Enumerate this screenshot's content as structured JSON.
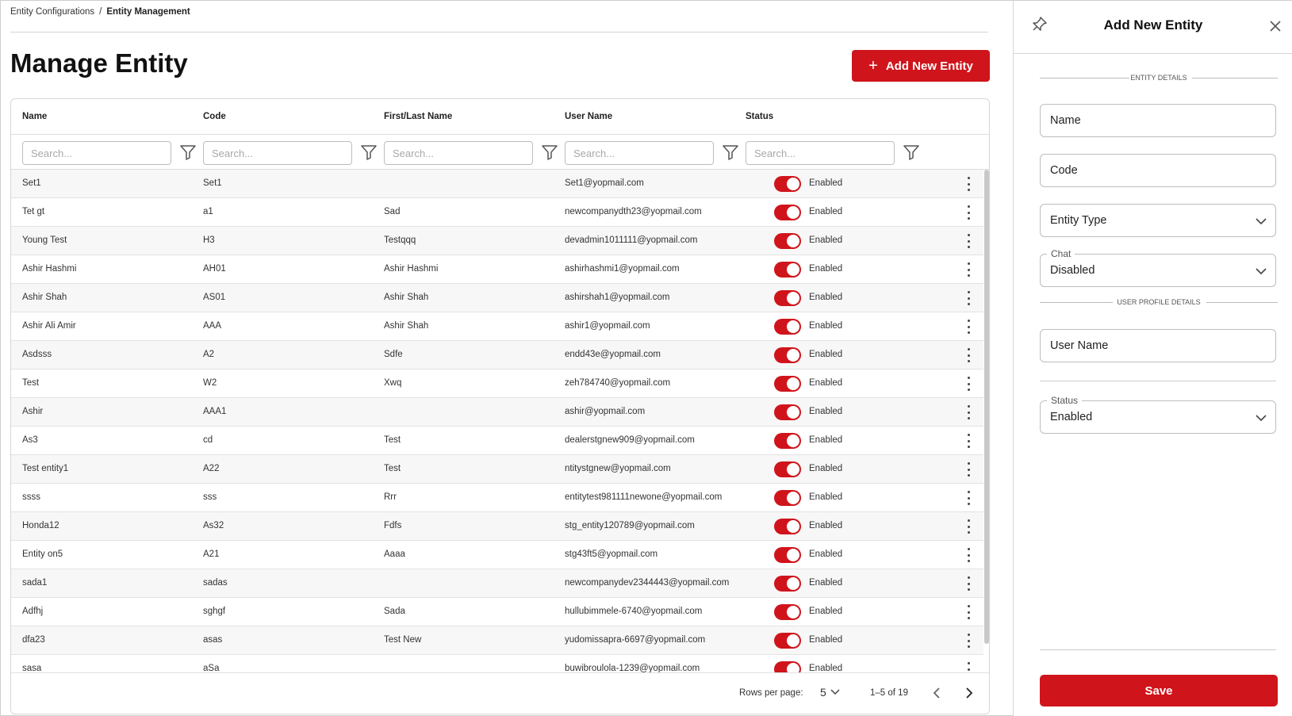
{
  "breadcrumb": {
    "parent": "Entity Configurations",
    "separator": "/",
    "current": "Entity Management"
  },
  "page": {
    "title": "Manage Entity",
    "add_button": "Add New Entity"
  },
  "table": {
    "columns": [
      "Name",
      "Code",
      "First/Last Name",
      "User Name",
      "Status"
    ],
    "search_placeholder": "Search...",
    "rows": [
      {
        "name": "Set1",
        "code": "Set1",
        "first_last": "",
        "user": "Set1@yopmail.com",
        "status": "Enabled"
      },
      {
        "name": "Tet gt",
        "code": "a1",
        "first_last": "Sad",
        "user": "newcompanydth23@yopmail.com",
        "status": "Enabled"
      },
      {
        "name": "Young Test",
        "code": "H3",
        "first_last": "Testqqq",
        "user": "devadmin1011111@yopmail.com",
        "status": "Enabled"
      },
      {
        "name": "Ashir Hashmi",
        "code": "AH01",
        "first_last": "Ashir Hashmi",
        "user": "ashirhashmi1@yopmail.com",
        "status": "Enabled"
      },
      {
        "name": "Ashir Shah",
        "code": "AS01",
        "first_last": "Ashir Shah",
        "user": "ashirshah1@yopmail.com",
        "status": "Enabled"
      },
      {
        "name": "Ashir Ali Amir",
        "code": "AAA",
        "first_last": "Ashir Shah",
        "user": "ashir1@yopmail.com",
        "status": "Enabled"
      },
      {
        "name": "Asdsss",
        "code": "A2",
        "first_last": "Sdfe",
        "user": "endd43e@yopmail.com",
        "status": "Enabled"
      },
      {
        "name": "Test",
        "code": "W2",
        "first_last": "Xwq",
        "user": "zeh784740@yopmail.com",
        "status": "Enabled"
      },
      {
        "name": "Ashir",
        "code": "AAA1",
        "first_last": "",
        "user": "ashir@yopmail.com",
        "status": "Enabled"
      },
      {
        "name": "As3",
        "code": "cd",
        "first_last": "Test",
        "user": "dealerstgnew909@yopmail.com",
        "status": "Enabled"
      },
      {
        "name": "Test entity1",
        "code": "A22",
        "first_last": "Test",
        "user": "ntitystgnew@yopmail.com",
        "status": "Enabled"
      },
      {
        "name": "ssss",
        "code": "sss",
        "first_last": "Rrr",
        "user": "entitytest981111newone@yopmail.com",
        "status": "Enabled"
      },
      {
        "name": "Honda12",
        "code": "As32",
        "first_last": "Fdfs",
        "user": "stg_entity120789@yopmail.com",
        "status": "Enabled"
      },
      {
        "name": "Entity on5",
        "code": "A21",
        "first_last": "Aaaa",
        "user": "stg43ft5@yopmail.com",
        "status": "Enabled"
      },
      {
        "name": "sada1",
        "code": "sadas",
        "first_last": "",
        "user": "newcompanydev2344443@yopmail.com",
        "status": "Enabled"
      },
      {
        "name": "Adfhj",
        "code": "sghgf",
        "first_last": "Sada",
        "user": "hullubimmele-6740@yopmail.com",
        "status": "Enabled"
      },
      {
        "name": "dfa23",
        "code": "asas",
        "first_last": "Test New",
        "user": "yudomissapra-6697@yopmail.com",
        "status": "Enabled"
      },
      {
        "name": "sasa",
        "code": "aSa",
        "first_last": "",
        "user": "buwibroulola-1239@yopmail.com",
        "status": "Enabled"
      }
    ],
    "footer": {
      "rows_per_page_label": "Rows per page:",
      "rows_per_page": "5",
      "range": "1–5 of 19"
    }
  },
  "panel": {
    "title": "Add New Entity",
    "section_entity": "ENTITY DETAILS",
    "name_placeholder": "Name",
    "code_placeholder": "Code",
    "entity_type_placeholder": "Entity Type",
    "chat_label": "Chat",
    "chat_value": "Disabled",
    "section_profile": "USER PROFILE DETAILS",
    "username_placeholder": "User Name",
    "status_label": "Status",
    "status_value": "Enabled",
    "save_label": "Save"
  },
  "colors": {
    "accent": "#d0141b"
  },
  "icons": [
    "plus-icon",
    "filter-icon",
    "kebab-icon",
    "chevron-down-icon",
    "chevron-left-icon",
    "chevron-right-icon",
    "pin-icon",
    "close-icon"
  ]
}
